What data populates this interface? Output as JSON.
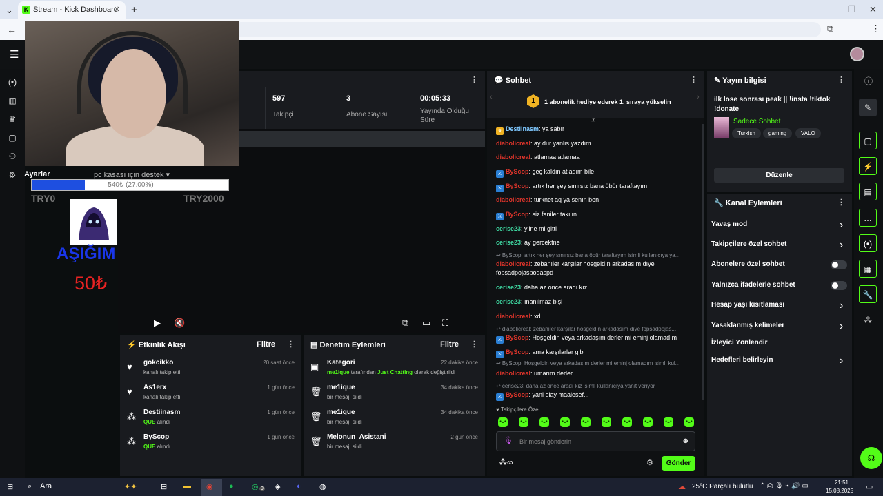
{
  "browser": {
    "tab_title": "Stream - Kick Dashboard",
    "tab_favicon": "K",
    "tab_close": "✕",
    "new_tab": "+"
  },
  "overlay": {
    "settings_label": "Ayarlar",
    "goal_title": "pc kasası için destek ▾",
    "goal_progress_text": "540₺ (27.00%)",
    "goal_progress_percent": 27,
    "goal_min": "TRY0",
    "goal_max": "TRY2000",
    "donor_name": "AŞIĞIM",
    "donor_amount": "50₺"
  },
  "stats": [
    {
      "value": "597",
      "label": "Takipçi"
    },
    {
      "value": "3",
      "label": "Abone Sayısı"
    },
    {
      "value": "00:05:33",
      "label": "Yayında Olduğu Süre"
    }
  ],
  "activity": {
    "title": "Etkinlik Akışı",
    "filter": "Filtre",
    "items": [
      {
        "icon": "heart-icon",
        "glyph": "♥",
        "name": "gokcikko",
        "desc": "kanalı takip etti",
        "desc_prefix": "",
        "time": "20 saat önce"
      },
      {
        "icon": "heart-icon",
        "glyph": "♥",
        "name": "As1erx",
        "desc": "kanalı takip etti",
        "desc_prefix": "",
        "time": "1 gün önce"
      },
      {
        "icon": "points-icon",
        "glyph": "⁂",
        "name": "Destiinasm",
        "desc_prefix": "QUE",
        "desc": " alındı",
        "time": "1 gün önce"
      },
      {
        "icon": "points-icon",
        "glyph": "⁂",
        "name": "ByScop",
        "desc_prefix": "QUE",
        "desc": " alındı",
        "time": "1 gün önce"
      }
    ]
  },
  "moderation": {
    "title": "Denetim Eylemleri",
    "filter": "Filtre",
    "items": [
      {
        "icon": "category-icon",
        "glyph": "▣",
        "name": "Kategori",
        "time": "22 dakika önce",
        "user": "me1ique",
        "mid": " tarafından ",
        "cat": "Just Chatting",
        "end": " olarak değiştirildi"
      },
      {
        "icon": "trash-icon",
        "glyph": "🗑",
        "name": "me1ique",
        "desc": "bir mesajı sildi",
        "time": "34 dakika önce"
      },
      {
        "icon": "trash-icon",
        "glyph": "🗑",
        "name": "me1ique",
        "desc": "bir mesajı sildi",
        "time": "34 dakika önce"
      },
      {
        "icon": "trash-icon",
        "glyph": "🗑",
        "name": "Melonun_Asistani",
        "desc": "bir mesajı sildi",
        "time": "2 gün önce"
      }
    ]
  },
  "chat": {
    "title": "Sohbet",
    "pinned": "1 abonelik hediye ederek 1. sıraya yükselin",
    "pinned_rank": "1",
    "messages": [
      {
        "user": "Destiinasm",
        "color": "#7ec8ff",
        "text": ": ya sabır",
        "badge": "crown"
      },
      {
        "user": "diabolicreal",
        "color": "#e0352b",
        "text": ": ay dur yanlıs yazdım"
      },
      {
        "user": "diabolicreal",
        "color": "#e0352b",
        "text": ": atlamaa atlamaa"
      },
      {
        "user": "ByScop",
        "color": "#e0352b",
        "text": ": geç kaldın atladım bile",
        "badge": "mod"
      },
      {
        "user": "ByScop",
        "color": "#e0352b",
        "text": ": artık her şey sınırsız bana öbür taraftayım",
        "badge": "mod"
      },
      {
        "user": "diabolicreal",
        "color": "#e0352b",
        "text": ": turknet aq ya senın ben"
      },
      {
        "user": "ByScop",
        "color": "#e0352b",
        "text": ": siz faniler takılın",
        "badge": "mod"
      },
      {
        "user": "cerise23",
        "color": "#3ed6a0",
        "text": ": yiine mi gitti"
      },
      {
        "user": "cerise23",
        "color": "#3ed6a0",
        "text": ": ay gercektne"
      },
      {
        "reply": "↩ ByScop: artık her şey sınırsız bana öbür taraftayım isimli kullanıcıya ya..."
      },
      {
        "user": "diabolicreal",
        "color": "#e0352b",
        "text": ": zebanıler karşılar hosgeldın arkadasım dıye fopsadpojaspodaspd"
      },
      {
        "user": "cerise23",
        "color": "#3ed6a0",
        "text": ": daha az once aradı kız"
      },
      {
        "user": "cerise23",
        "color": "#3ed6a0",
        "text": ": ınanılmaz bişi"
      },
      {
        "user": "diabolicreal",
        "color": "#e0352b",
        "text": ": xd"
      },
      {
        "reply": "↩ diabolicreal: zebanıler karşılar hosgeldın arkadasım dıye fopsadpojas..."
      },
      {
        "user": "ByScop",
        "color": "#e0352b",
        "text": ": Hoşgeldin veya arkadaşım derler mi eminj olamadım",
        "badge": "mod"
      },
      {
        "user": "ByScop",
        "color": "#e0352b",
        "text": ": ama karşılarlar gibi",
        "badge": "mod"
      },
      {
        "reply": "↩ ByScop: Hoşgeldin veya arkadaşım derler mi eminj olamadım isimli kul..."
      },
      {
        "user": "diabolicreal",
        "color": "#e0352b",
        "text": ": umarım derler"
      },
      {
        "reply": "↩ cerise23: daha az once aradı kız isimli kullanıcıya yanıt veriyor"
      },
      {
        "user": "ByScop",
        "color": "#e0352b",
        "text": ": yani olay maalesef...",
        "badge": "mod"
      }
    ],
    "followers_only": "♥ Takipçilere Özel",
    "input_placeholder": "Bir mesaj gönderin",
    "send": "Gönder"
  },
  "stream_info": {
    "title": "Yayın bilgisi",
    "stream_title": "ilk lose sonrası peak || !insta !tiktok !donate",
    "category": "Sadece Sohbet",
    "tags": [
      "Turkish",
      "gaming",
      "VALO"
    ],
    "edit": "Düzenle"
  },
  "channel_actions": {
    "title": "Kanal Eylemleri",
    "items": [
      {
        "label": "Yavaş mod",
        "control": "chevron"
      },
      {
        "label": "Takipçilere özel sohbet",
        "control": "chevron"
      },
      {
        "label": "Abonelere özel sohbet",
        "control": "toggle"
      },
      {
        "label": "Yalnızca ifadelerle sohbet",
        "control": "toggle"
      },
      {
        "label": "Hesap yaşı kısıtlaması",
        "control": "chevron"
      },
      {
        "label": "Yasaklanmış kelimeler",
        "control": "chevron"
      },
      {
        "label": "İzleyici Yönlendir",
        "control": "none"
      },
      {
        "label": "Hedefleri belirleyin",
        "control": "chevron"
      }
    ]
  },
  "taskbar": {
    "search": "Ara",
    "weather": "25°C  Parçalı bulutlu",
    "time": "21:51",
    "date": "15.08.2025",
    "whatsapp_badge": "9"
  },
  "colors": {
    "accent": "#53fc18",
    "panel": "#191b1f",
    "background": "#0b0e0f"
  }
}
